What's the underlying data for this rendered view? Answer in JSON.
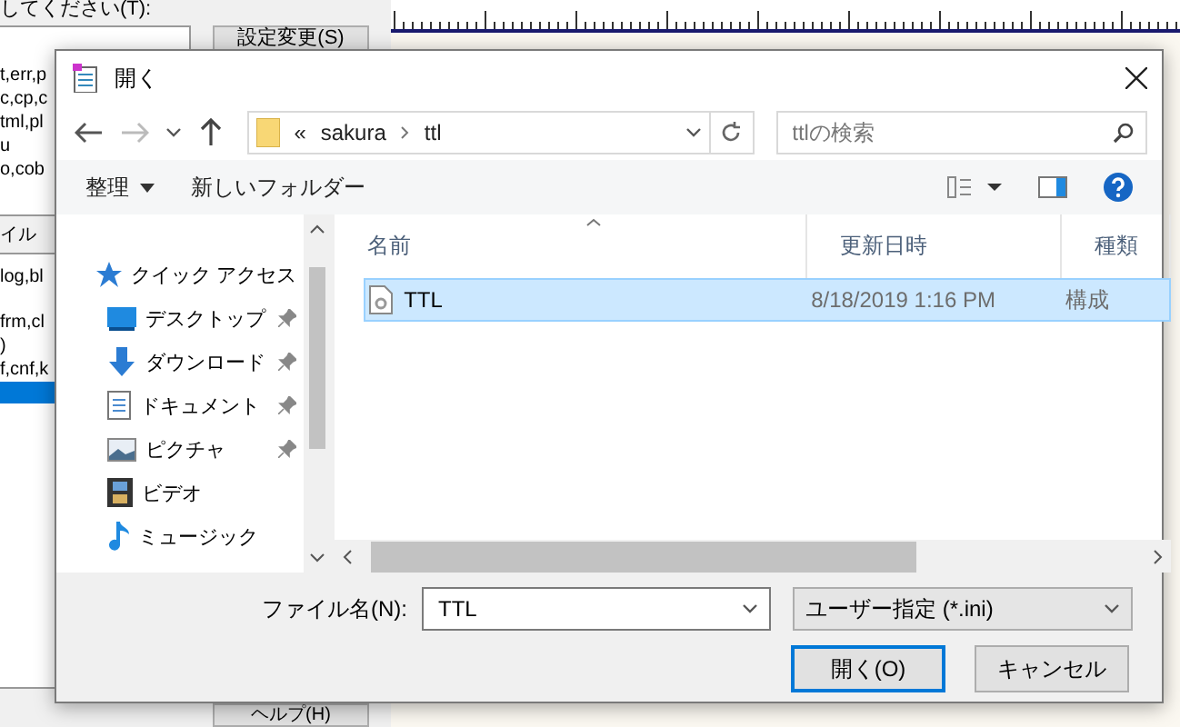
{
  "background_app": {
    "prompt": "してください(T):",
    "list_1": [
      "t,err,p",
      "c,cp,c",
      "tml,pl",
      "u",
      "o,cob"
    ],
    "section_label": "イル",
    "list_2": [
      {
        "text": "log,bl",
        "selected": false
      },
      {
        "text": "frm,cl",
        "selected": false
      },
      {
        "text": ")",
        "selected": false
      },
      {
        "text": "f,cnf,k",
        "selected": false
      }
    ],
    "blank_row_selected": true,
    "buttons": [
      "設定変更(S)",
      "ヘルプ(H)"
    ]
  },
  "dialog": {
    "title": "開く",
    "nav": {
      "back_enabled": true,
      "forward_enabled": false
    },
    "address": [
      "«",
      "sakura",
      "ttl"
    ],
    "search": {
      "placeholder": "ttlの検索"
    },
    "toolbar": {
      "organize": "整理",
      "new_folder": "新しいフォルダー"
    },
    "sidebar": {
      "header": "クイック アクセス",
      "items": [
        {
          "label": "デスクトップ",
          "kind": "desktop",
          "pinned": true
        },
        {
          "label": "ダウンロード",
          "kind": "download",
          "pinned": true
        },
        {
          "label": "ドキュメント",
          "kind": "document",
          "pinned": true
        },
        {
          "label": "ピクチャ",
          "kind": "pictures",
          "pinned": true
        },
        {
          "label": "ビデオ",
          "kind": "video",
          "pinned": false
        },
        {
          "label": "ミュージック",
          "kind": "music",
          "pinned": false
        }
      ]
    },
    "table": {
      "columns": [
        "名前",
        "更新日時",
        "種類"
      ],
      "rows": [
        {
          "name": "TTL",
          "modified": "8/18/2019 1:16 PM",
          "type": "構成",
          "selected": true
        }
      ]
    },
    "filename": {
      "label": "ファイル名(N):",
      "value": "TTL"
    },
    "filter": "ユーザー指定 (*.ini)",
    "buttons": [
      {
        "label": "開く(O)",
        "default": true
      },
      {
        "label": "キャンセル",
        "default": false
      }
    ]
  }
}
